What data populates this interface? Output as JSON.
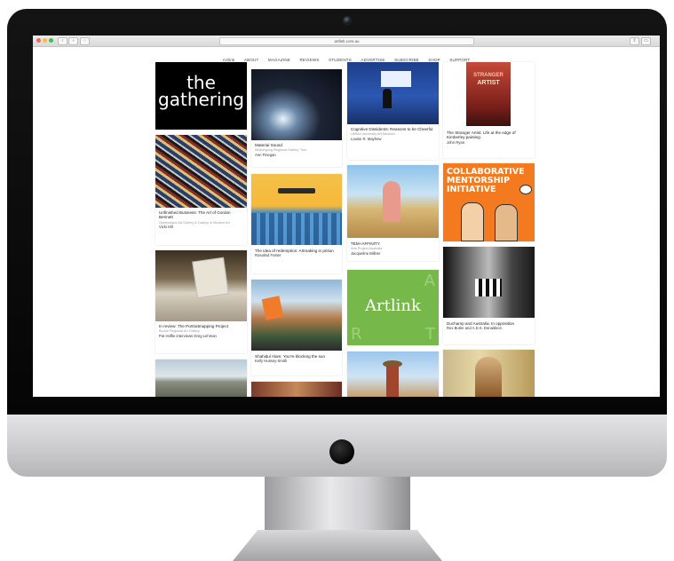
{
  "browser": {
    "url": "artlink.com.au",
    "back_icon": "chevron-left-icon",
    "forward_icon": "chevron-right-icon"
  },
  "nav": {
    "items": [
      "Artlink",
      "ABOUT",
      "MAGAZINE",
      "REVIEWS",
      "STUDENTS",
      "ADVERTISE",
      "SUBSCRIBE",
      "SHOP",
      "SUPPORT"
    ]
  },
  "cards": {
    "c1": {
      "logo_line1": "the",
      "logo_line2": "gathering"
    },
    "c2": {
      "title": "Unfinished Business: The Art of Gordon Bennett",
      "venue": "Queensland Art Gallery & Gallery of Modern Art",
      "author": "Vicki Hill"
    },
    "c3": {
      "title": "In review: The Portraitmapping Project",
      "venue": "Burnie Regional Art Gallery",
      "author": "Pat Hoffie interviews Greg Lehman"
    },
    "c5": {
      "title": "Material Sound",
      "venue": "Wollongong Regional Gallery, Tour",
      "author": "Ann Finegan"
    },
    "c6": {
      "title": "The idea of redemption: Artmaking in prison",
      "author": "Rosalind Foster"
    },
    "c7": {
      "title": "Shahidul Alam: You're blocking the sun",
      "author": "Kelly Hussey-Smith"
    },
    "c9": {
      "title": "Cognitive Dissidents: Reasons to be Cheerful",
      "venue": "UMMA University Art Museum",
      "author": "Louise R. Mayhew"
    },
    "c10": {
      "title": "TEM+AFFINITY",
      "venue": "Arts Project Australia",
      "author": "Jacqueline Millner"
    },
    "c11": {
      "word": "Artlink",
      "corner_tl": "A",
      "corner_br": "T",
      "corner_bl": "R"
    },
    "c13": {
      "cover_line1": "STRANGER",
      "cover_line2": "ARTIST",
      "title": "The Stranger Artist: Life at the edge of Kimberley painting",
      "author": "John Ryan"
    },
    "c14": {
      "banner": "COLLABORATIVE MENTORSHIP INITIATIVE"
    },
    "c15": {
      "title": "Duchamp and Australia: In opposition",
      "author": "Rex Butler and A.D.S. Donaldson"
    }
  },
  "colors": {
    "orange": "#f47a20",
    "green": "#77b84a"
  }
}
